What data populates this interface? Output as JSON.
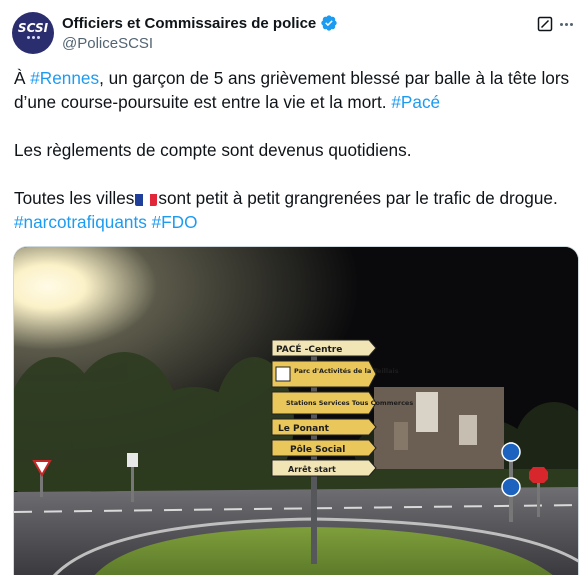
{
  "author": {
    "display_name": "Officiers et Commissaires de police",
    "handle": "@PoliceSCSI",
    "avatar_text": "SCSI",
    "verified": true
  },
  "tweet": {
    "line1_prefix": "À ",
    "hashtag_rennes": "#Rennes",
    "line1_body": ", un garçon de 5 ans grièvement blessé par balle à la tête lors d’une course-poursuite est entre la vie et la mort. ",
    "hashtag_pace": "#Pacé",
    "line2": "Les règlements de compte sont devenus quotidiens.",
    "line3_prefix": "Toutes les villes",
    "line3_body": "sont petit à petit grangrenées par le trafic de drogue.",
    "hashtag_narco": "#narcotrafiquants",
    "hashtag_fdo": "#FDO"
  },
  "media": {
    "signs": [
      "PACÉ -Centre",
      "Parc d'Activités de la Teillais",
      "Stations Services Tous Commerces",
      "Le Ponant",
      "Pôle Social",
      "Arrêt start"
    ]
  },
  "colors": {
    "link": "#1d9bf0",
    "text": "#0f1419",
    "secondary": "#536471",
    "verified": "#1d9bf0",
    "sign_yellow": "#e9c75a"
  },
  "icons": [
    "verified-badge-icon",
    "grok-icon",
    "more-icon",
    "french-flag-icon"
  ]
}
